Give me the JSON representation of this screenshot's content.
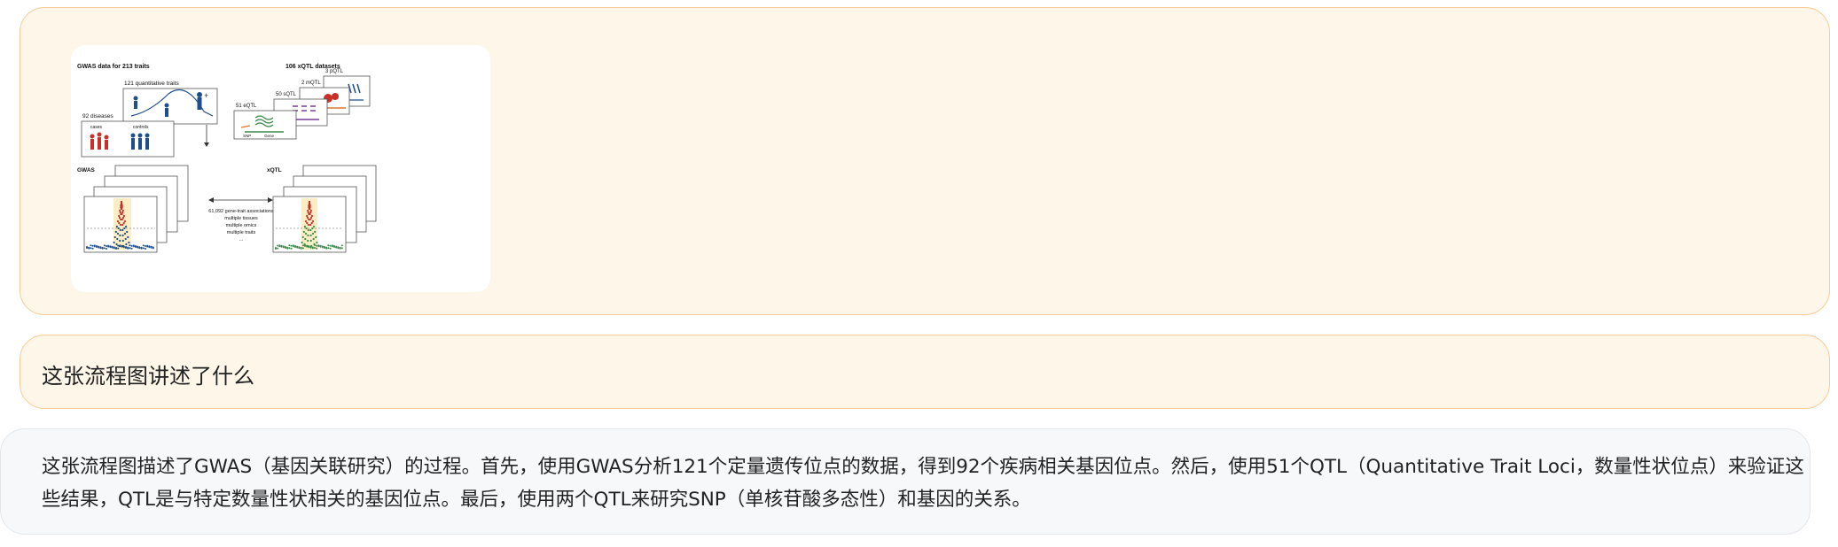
{
  "figure": {
    "left_title": "GWAS data for 213 traits",
    "right_title": "106 xQTL datasets",
    "quant_label": "121 quantitative traits",
    "disease_label": "92 diseases",
    "cases_label": "cases",
    "controls_label": "controls",
    "plus_sign": "+",
    "pqtl_label": "3 pQTL",
    "mqtl_label": "2 mQTL",
    "sqtl_label": "50 sQTL",
    "eqtl_label": "51 eQTL",
    "snp_label": "SNP",
    "gene_label": "Gene",
    "gwas_label": "GWAS",
    "xqtl_label": "xQTL",
    "assoc_lines": [
      "61,092 gene-trait associations",
      "multiple tissues",
      "multiple omics",
      "multiple traits",
      "..."
    ],
    "colors": {
      "red": "#c8302a",
      "blue": "#1f4e8c",
      "green": "#3d8a4a",
      "purple": "#7b3c96",
      "orange": "#e0772a",
      "highlight": "#fbeec4"
    }
  },
  "question": {
    "text": "这张流程图讲述了什么"
  },
  "answer": {
    "text": "这张流程图描述了GWAS（基因关联研究）的过程。首先，使用GWAS分析121个定量遗传位点的数据，得到92个疾病相关基因位点。然后，使用51个QTL（Quantitative Trait Loci，数量性状位点）来验证这些结果，QTL是与特定数量性状相关的基因位点。最后，使用两个QTL来研究SNP（单核苷酸多态性）和基因的关系。"
  }
}
